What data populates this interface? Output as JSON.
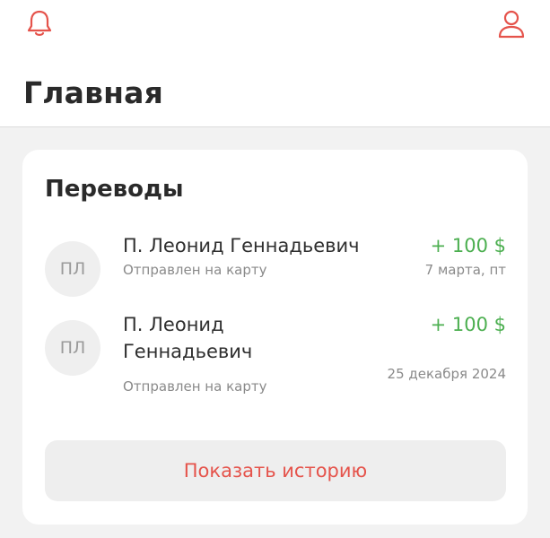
{
  "header": {
    "bell_icon": "bell-icon",
    "profile_icon": "user-icon",
    "title": "Главная"
  },
  "transfers": {
    "title": "Переводы",
    "items": [
      {
        "initials": "ПЛ",
        "name": "П. Леонид Геннадьевич",
        "status": "Отправлен на карту",
        "amount": "+ 100 $",
        "date": "7 марта, пт"
      },
      {
        "initials": "ПЛ",
        "name": "П. Леонид Геннадьевич",
        "status": "Отправлен на карту",
        "amount": "+ 100 $",
        "date": "25 декабря 2024"
      }
    ],
    "history_button": "Показать историю"
  },
  "colors": {
    "accent": "#e5534b",
    "positive": "#4caf50",
    "background": "#f2f2f2"
  }
}
